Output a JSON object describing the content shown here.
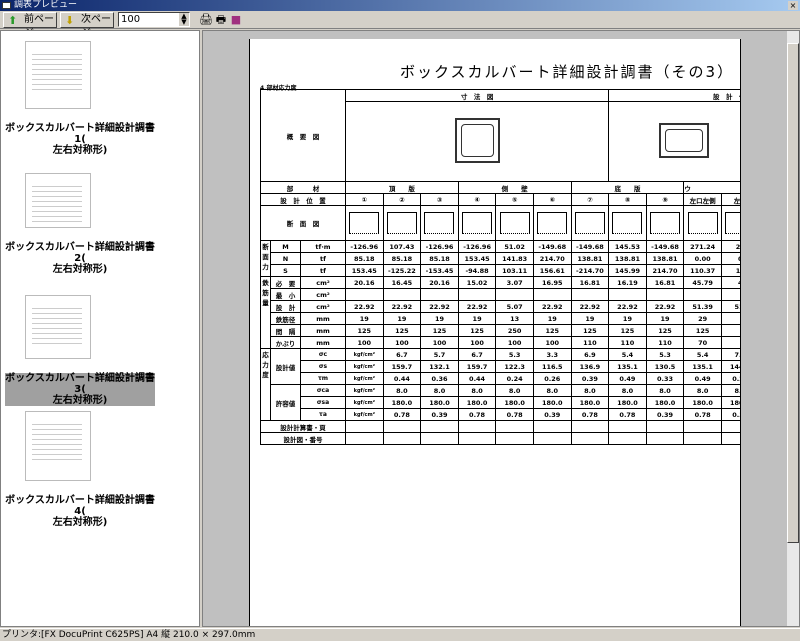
{
  "window": {
    "title": "調表プレビュー",
    "close": "×"
  },
  "toolbar": {
    "prev": "前ページ",
    "next": "次ページ",
    "zoom": "100",
    "icons": [
      "print-setup-icon",
      "printer-icon",
      "book-icon"
    ]
  },
  "thumbnails": [
    {
      "label1": "ボックスカルバート詳細設計調書1(",
      "label2": "左右対称形)",
      "selected": false
    },
    {
      "label1": "ボックスカルバート詳細設計調書2(",
      "label2": "左右対称形)",
      "selected": false
    },
    {
      "label1": "ボックスカルバート詳細設計調書3(",
      "label2": "左右対称形)",
      "selected": true
    },
    {
      "label1": "ボックスカルバート詳細設計調書4(",
      "label2": "左右対称形)",
      "selected": false
    }
  ],
  "document": {
    "title": "ボックスカルバート詳細設計調書（その3）",
    "section": "4.部材応力度",
    "overview_label": "概　要　図",
    "dim_header": "寸　法　図",
    "pos_header": "設　計　位　置",
    "member_label": "部　　　材",
    "position_label": "設　計　位　置",
    "section_label": "断　面　図",
    "groups": [
      "頂　　版",
      "側　　壁",
      "底　　版",
      "ウ"
    ],
    "positions": [
      "①",
      "②",
      "③",
      "④",
      "⑤",
      "⑥",
      "⑦",
      "⑧",
      "⑨",
      "左口左側",
      "左口"
    ],
    "rows": [
      {
        "group": "断面力",
        "name": "M",
        "unit": "tf·m",
        "values": [
          "-126.96",
          "107.43",
          "-126.96",
          "-126.96",
          "51.02",
          "-149.68",
          "-149.68",
          "145.53",
          "-149.68",
          "271.24",
          "27"
        ]
      },
      {
        "group": "",
        "name": "N",
        "unit": "tf",
        "values": [
          "85.18",
          "85.18",
          "85.18",
          "153.45",
          "141.83",
          "214.70",
          "138.81",
          "138.81",
          "138.81",
          "0.00",
          "0"
        ]
      },
      {
        "group": "",
        "name": "S",
        "unit": "tf",
        "values": [
          "153.45",
          "-125.22",
          "-153.45",
          "-94.88",
          "103.11",
          "156.61",
          "-214.70",
          "145.99",
          "214.70",
          "110.37",
          "11"
        ]
      },
      {
        "group": "鉄筋量",
        "name": "必　要",
        "unit": "cm²",
        "values": [
          "20.16",
          "16.45",
          "20.16",
          "15.02",
          "3.07",
          "16.95",
          "16.81",
          "16.19",
          "16.81",
          "45.79",
          "4"
        ]
      },
      {
        "group": "",
        "name": "最　小",
        "unit": "cm²",
        "values": [
          "",
          "",
          "",
          "",
          "",
          "",
          "",
          "",
          "",
          "",
          ""
        ]
      },
      {
        "group": "",
        "name": "設　計",
        "unit": "cm²",
        "values": [
          "22.92",
          "22.92",
          "22.92",
          "22.92",
          "5.07",
          "22.92",
          "22.92",
          "22.92",
          "22.92",
          "51.39",
          "51."
        ]
      },
      {
        "group": "",
        "name": "鉄筋径",
        "unit": "mm",
        "values": [
          "19",
          "19",
          "19",
          "19",
          "13",
          "19",
          "19",
          "19",
          "19",
          "29",
          ""
        ]
      },
      {
        "group": "",
        "name": "間　隔",
        "unit": "mm",
        "values": [
          "125",
          "125",
          "125",
          "125",
          "250",
          "125",
          "125",
          "125",
          "125",
          "125",
          ""
        ]
      },
      {
        "group": "",
        "name": "かぶり",
        "unit": "mm",
        "values": [
          "100",
          "100",
          "100",
          "100",
          "100",
          "100",
          "110",
          "110",
          "110",
          "70",
          ""
        ]
      },
      {
        "group": "応力度",
        "sub": "設計値",
        "name": "σc",
        "unit": "kgf/cm²",
        "values": [
          "6.7",
          "5.7",
          "6.7",
          "5.3",
          "3.3",
          "6.9",
          "5.4",
          "5.3",
          "5.4",
          "7.7",
          ""
        ]
      },
      {
        "group": "",
        "name": "σs",
        "unit": "kgf/cm²",
        "values": [
          "159.7",
          "132.1",
          "159.7",
          "122.3",
          "116.5",
          "136.9",
          "135.1",
          "130.5",
          "135.1",
          "144.2",
          "1."
        ]
      },
      {
        "group": "",
        "name": "τm",
        "unit": "kgf/cm²",
        "values": [
          "0.44",
          "0.36",
          "0.44",
          "0.24",
          "0.26",
          "0.39",
          "0.49",
          "0.33",
          "0.49",
          "0.26",
          ""
        ]
      },
      {
        "group": "",
        "sub": "許容値",
        "name": "σca",
        "unit": "kgf/cm²",
        "values": [
          "8.0",
          "8.0",
          "8.0",
          "8.0",
          "8.0",
          "8.0",
          "8.0",
          "8.0",
          "8.0",
          "8.0",
          ""
        ]
      },
      {
        "group": "",
        "name": "σsa",
        "unit": "kgf/cm²",
        "values": [
          "180.0",
          "180.0",
          "180.0",
          "180.0",
          "180.0",
          "180.0",
          "180.0",
          "180.0",
          "180.0",
          "180.0",
          "1"
        ]
      },
      {
        "group": "",
        "name": "τa",
        "unit": "kgf/cm²",
        "values": [
          "0.78",
          "0.39",
          "0.78",
          "0.78",
          "0.39",
          "0.78",
          "0.78",
          "0.39",
          "0.78",
          "0.39",
          ""
        ]
      }
    ],
    "calc_page_label": "設計計算書・頁",
    "drawing_no_label": "設計図・番号"
  },
  "status": "プリンタ:[FX DocuPrint C625PS] A4 縦  210.0 × 297.0mm"
}
